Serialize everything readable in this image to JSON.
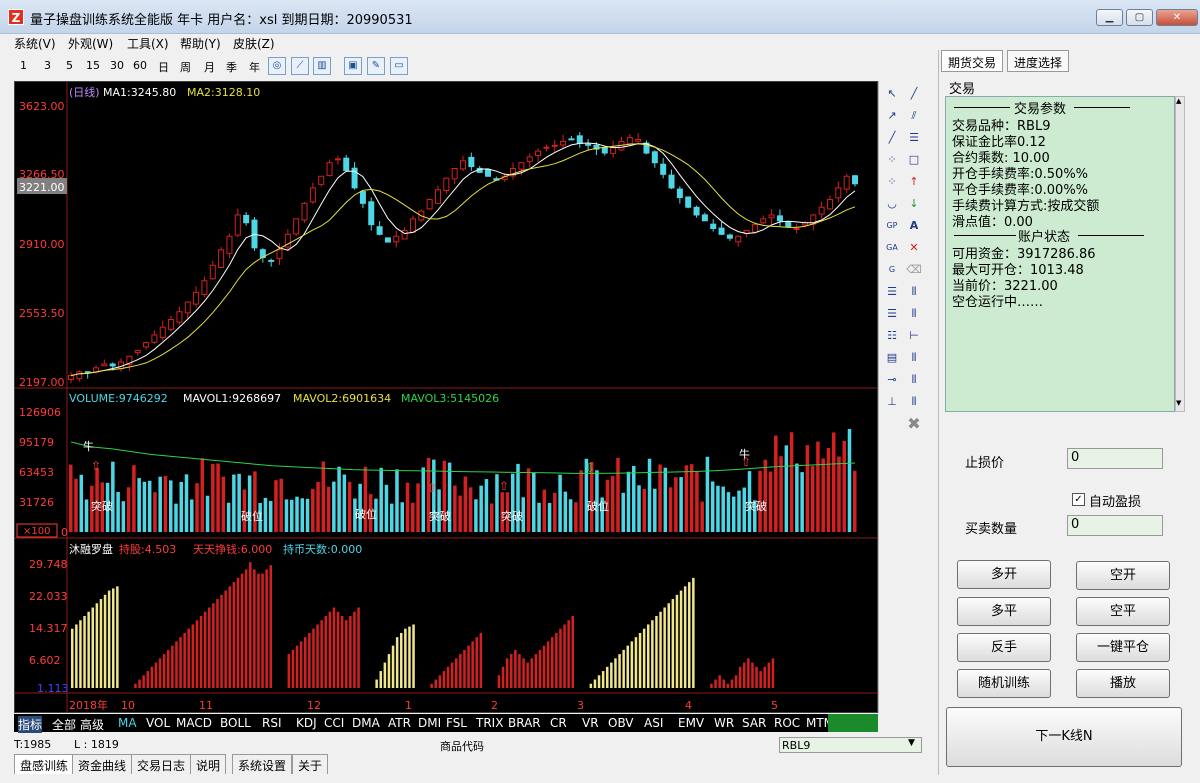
{
  "window": {
    "title": "量子操盘训练系统全能版 年卡 用户名：xsl 到期日期：20990531",
    "icon_letter": "Z"
  },
  "menu": [
    "系统(V)",
    "外观(W)",
    "工具(X)",
    "帮助(Y)",
    "皮肤(Z)"
  ],
  "periods": [
    "1",
    "3",
    "5",
    "15",
    "30",
    "60",
    "日",
    "周",
    "月",
    "季",
    "年"
  ],
  "chart": {
    "price_header": {
      "period": "(日线)",
      "ma1": "MA1:3245.80",
      "ma2": "MA2:3128.10"
    },
    "price_axis": [
      "3623.00",
      "3266.50",
      "2910.00",
      "2553.50",
      "2197.00"
    ],
    "current_price": "3221.00",
    "volume_header": {
      "volume": "VOLUME:9746292",
      "mavol1": "MAVOL1:9268697",
      "mavol2": "MAVOL2:6901634",
      "mavol3": "MAVOL3:5145026"
    },
    "volume_axis": [
      "126906",
      "95179",
      "63453",
      "31726",
      "0"
    ],
    "volume_unit": "×100",
    "volume_labels": [
      "突破",
      "破位",
      "破位",
      "突破",
      "突破",
      "破位",
      "突破"
    ],
    "bull_labels": [
      "牛",
      "牛"
    ],
    "indicator_header": {
      "name": "沐融罗盘",
      "v1": "持股:4.503",
      "v2": "天天挣钱:6.000",
      "v3": "持币天数:0.000"
    },
    "indicator_axis": [
      "29.748",
      "22.033",
      "14.317",
      "6.602",
      "1.113"
    ],
    "time_axis": [
      "2018年",
      "10",
      "11",
      "12",
      "1",
      "2",
      "3",
      "4",
      "5"
    ]
  },
  "indicator_tabs": [
    "指标",
    "全部",
    "高级",
    "MA",
    "VOL",
    "MACD",
    "BOLL",
    "RSI",
    "KDJ",
    "CCI",
    "DMA",
    "ATR",
    "DMI",
    "FSL",
    "TRIX",
    "BRAR",
    "CR",
    "VR",
    "OBV",
    "ASI",
    "EMV",
    "WR",
    "SAR",
    "ROC",
    "MTM"
  ],
  "status": {
    "t": "T:1985",
    "l": "L : 1819",
    "code_label": "商品代码",
    "code_value": "RBL9"
  },
  "bottom_tabs": [
    "盘感训练",
    "资金曲线",
    "交易日志",
    "说明",
    "系统设置",
    "关于"
  ],
  "right_panel": {
    "tabs": [
      "期货交易",
      "进度选择"
    ],
    "section": "交易",
    "trade_params_title": "交易参数",
    "trade_params": [
      "交易品种：RBL9",
      "保证金比率0.12",
      " 合约乘数: 10.00",
      "开仓手续费率:0.50%%",
      " 平仓手续费率:0.00%%",
      " 手续费计算方式:按成交额",
      "滑点值：0.00"
    ],
    "account_title": "账户状态",
    "account": [
      "可用资金：3917286.86",
      "最大可开仓：1013.48",
      "当前价：3221.00",
      "空仓运行中……"
    ],
    "stop_loss_label": "止损价",
    "stop_loss_value": "0",
    "auto_tp_label": "自动盈损",
    "qty_label": "买卖数量",
    "qty_value": "0",
    "buttons": [
      "多开",
      "空开",
      "多平",
      "空平",
      "反手",
      "一键平仓",
      "随机训练",
      "播放"
    ],
    "next_button": "下一K线N"
  },
  "colors": {
    "up": "#d42020",
    "down": "#4dd6e6",
    "ma1": "#ffffff",
    "ma2": "#e6e040",
    "vol_green": "#2bd44a",
    "axis_red": "#ff3b3b"
  },
  "chart_data": {
    "type": "candlestick",
    "note_kind": "daily",
    "closes": [
      2230,
      2250,
      2245,
      2270,
      2290,
      2280,
      2300,
      2330,
      2360,
      2400,
      2440,
      2480,
      2520,
      2560,
      2610,
      2660,
      2720,
      2800,
      2880,
      2950,
      3060,
      3020,
      2890,
      2840,
      2820,
      2880,
      2960,
      3040,
      3120,
      3200,
      3260,
      3330,
      3350,
      3290,
      3200,
      3120,
      3010,
      2960,
      2920,
      2950,
      2980,
      3040,
      3080,
      3140,
      3190,
      3250,
      3300,
      3340,
      3310,
      3280,
      3260,
      3240,
      3260,
      3300,
      3330,
      3360,
      3390,
      3410,
      3420,
      3440,
      3450,
      3430,
      3420,
      3400,
      3380,
      3410,
      3440,
      3460,
      3450,
      3380,
      3330,
      3270,
      3200,
      3150,
      3100,
      3060,
      3030,
      2990,
      2960,
      2940,
      2950,
      2980,
      3010,
      3040,
      3060,
      3030,
      3000,
      2990,
      3020,
      3060,
      3100,
      3140,
      3200,
      3260,
      3221
    ],
    "mavol_line1": [
      95179,
      90000,
      88000,
      85000,
      82000,
      80000,
      78000,
      76000,
      74000,
      72000,
      70000,
      69000,
      68000,
      67000,
      66000,
      65500,
      65000,
      64800,
      64500,
      64000,
      63800,
      63500,
      63000,
      62800,
      62500,
      62000,
      62000,
      62200,
      62500,
      63000,
      63500,
      64000,
      64800,
      66000,
      67500,
      69000,
      70000,
      71000,
      72000,
      73000
    ],
    "indicator_groups": [
      {
        "color": "yellow",
        "values": [
          14,
          15,
          16,
          17,
          18,
          19,
          20,
          21,
          22,
          23,
          23.5,
          24
        ]
      },
      {
        "color": "red",
        "values": [
          1,
          2,
          3,
          4,
          5,
          6,
          7,
          8,
          9,
          10,
          11,
          12,
          13,
          14,
          15,
          16,
          17,
          18,
          19,
          20,
          21,
          22,
          23,
          24,
          25,
          26,
          27,
          28,
          29.7,
          28,
          27,
          27,
          28,
          29
        ]
      },
      {
        "color": "red",
        "values": [
          8,
          9,
          10,
          11,
          12,
          13,
          14,
          15,
          16,
          17,
          18,
          19,
          18,
          17,
          16,
          17,
          18,
          19
        ]
      },
      {
        "color": "yellow",
        "values": [
          2,
          4,
          6,
          8,
          10,
          12,
          13,
          14,
          14.5,
          15
        ]
      },
      {
        "color": "red",
        "values": [
          1,
          2,
          3,
          4,
          5,
          6,
          7,
          8,
          9,
          10,
          11,
          12,
          13
        ]
      },
      {
        "color": "red",
        "values": [
          3,
          5,
          7,
          8,
          9,
          8,
          7,
          6,
          7,
          8,
          9,
          10,
          11,
          12,
          13,
          14,
          15,
          16,
          17
        ]
      },
      {
        "color": "yellow",
        "values": [
          1,
          2,
          3,
          4,
          5,
          6,
          7,
          8,
          9,
          10,
          11,
          12,
          13,
          14,
          15,
          16,
          17,
          18,
          19,
          20,
          21,
          22,
          23,
          24,
          25,
          26
        ]
      },
      {
        "color": "red",
        "values": [
          1,
          2,
          3,
          2,
          1,
          2,
          3,
          5,
          6,
          7,
          6,
          5,
          4,
          5,
          6,
          7
        ]
      }
    ]
  }
}
